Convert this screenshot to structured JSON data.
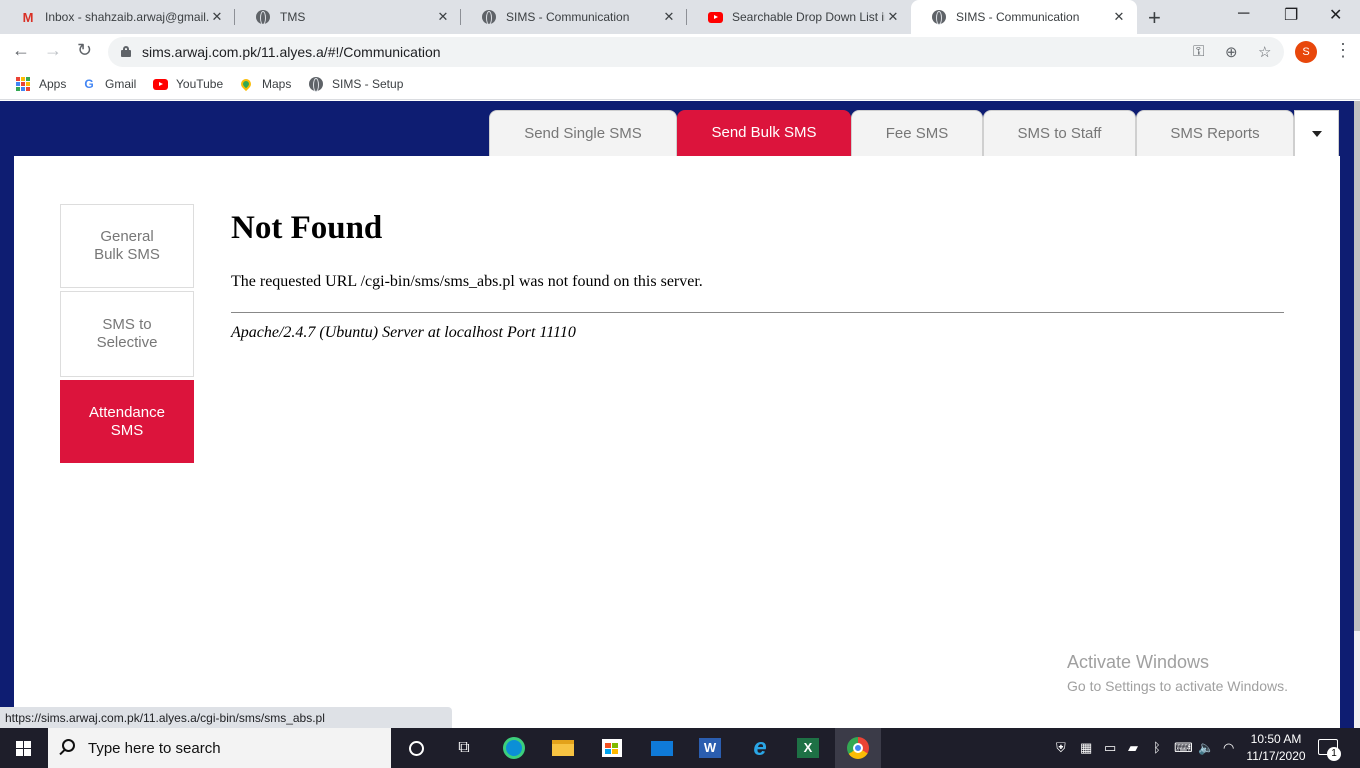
{
  "browser": {
    "tabs": [
      {
        "title": "Inbox - shahzaib.arwaj@gmail.",
        "icon": "gmail-icon"
      },
      {
        "title": "TMS",
        "icon": "globe-icon"
      },
      {
        "title": "SIMS - Communication",
        "icon": "globe-icon"
      },
      {
        "title": "Searchable Drop Down List in",
        "icon": "youtube-icon"
      },
      {
        "title": "SIMS - Communication",
        "icon": "globe-icon",
        "active": true
      }
    ],
    "url": "sims.arwaj.com.pk/11.alyes.a/#!/Communication",
    "profile_initial": "S",
    "bookmarks": [
      {
        "label": "Apps",
        "icon": "apps-grid-icon"
      },
      {
        "label": "Gmail",
        "icon": "google-icon"
      },
      {
        "label": "YouTube",
        "icon": "youtube-icon"
      },
      {
        "label": "Maps",
        "icon": "maps-pin-icon"
      },
      {
        "label": "SIMS - Setup",
        "icon": "globe-icon"
      }
    ],
    "status_url": "https://sims.arwaj.com.pk/11.alyes.a/cgi-bin/sms/sms_abs.pl"
  },
  "app": {
    "top_tabs": [
      {
        "label": "Send Single SMS",
        "active": false
      },
      {
        "label": "Send Bulk SMS",
        "active": true
      },
      {
        "label": "Fee SMS",
        "active": false
      },
      {
        "label": "SMS to Staff",
        "active": false
      },
      {
        "label": "SMS Reports",
        "active": false
      }
    ],
    "side_buttons": [
      {
        "label": "General Bulk SMS",
        "active": false
      },
      {
        "label": "SMS to Selective",
        "active": false
      },
      {
        "label": "Attendance SMS",
        "active": true
      }
    ],
    "error": {
      "title": "Not Found",
      "message": "The requested URL /cgi-bin/sms/sms_abs.pl was not found on this server.",
      "address": "Apache/2.4.7 (Ubuntu) Server at localhost Port 11110"
    },
    "accent_color": "#dc143c",
    "header_color": "#0e1d72"
  },
  "watermark": {
    "line1": "Activate Windows",
    "line2": "Go to Settings to activate Windows."
  },
  "taskbar": {
    "search_placeholder": "Type here to search",
    "time": "10:50 AM",
    "date": "11/17/2020",
    "notification_count": "1"
  }
}
